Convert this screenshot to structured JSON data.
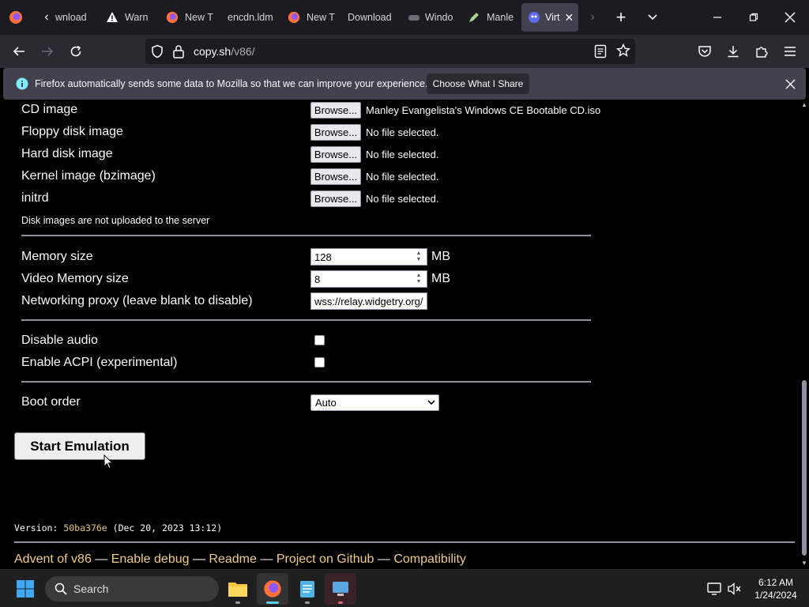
{
  "browser": {
    "tabs": [
      {
        "label": "wnload",
        "icon": "chevron-left-icon"
      },
      {
        "label": "Warn",
        "icon": "warning-icon"
      },
      {
        "label": "New T",
        "icon": "firefox-icon"
      },
      {
        "label": "encdn.ldm",
        "icon": ""
      },
      {
        "label": "New T",
        "icon": "firefox-icon"
      },
      {
        "label": "Download",
        "icon": ""
      },
      {
        "label": "Windo",
        "icon": "gamepad-icon"
      },
      {
        "label": "Manle",
        "icon": "pencil-icon"
      },
      {
        "label": "Virt",
        "icon": "v86-icon",
        "active": true
      }
    ],
    "url_host": "copy.sh",
    "url_path": "/v86/"
  },
  "notification": {
    "text": "Firefox automatically sends some data to Mozilla so that we can improve your experience.",
    "button": "Choose What I Share"
  },
  "form": {
    "files": [
      {
        "label": "CD image",
        "button": "Browse...",
        "value": "Manley Evangelista's Windows CE Bootable CD.iso"
      },
      {
        "label": "Floppy disk image",
        "button": "Browse...",
        "value": "No file selected."
      },
      {
        "label": "Hard disk image",
        "button": "Browse...",
        "value": "No file selected."
      },
      {
        "label": "Kernel image (bzimage)",
        "button": "Browse...",
        "value": "No file selected."
      },
      {
        "label": "initrd",
        "button": "Browse...",
        "value": "No file selected."
      }
    ],
    "disk_note": "Disk images are not uploaded to the server",
    "memory_label": "Memory size",
    "memory_value": "128",
    "memory_unit": "MB",
    "vram_label": "Video Memory size",
    "vram_value": "8",
    "vram_unit": "MB",
    "proxy_label": "Networking proxy (leave blank to disable)",
    "proxy_value": "wss://relay.widgetry.org/",
    "disable_audio_label": "Disable audio",
    "acpi_label": "Enable ACPI (experimental)",
    "boot_label": "Boot order",
    "boot_value": "Auto",
    "start_button": "Start Emulation"
  },
  "version": {
    "prefix": "Version:",
    "hash": "50ba376e",
    "date": "(Dec 20, 2023 13:12)"
  },
  "footer": {
    "links": [
      "Advent of v86",
      "Enable debug",
      "Readme",
      "Project on Github",
      "Compatibility"
    ],
    "separator": "—"
  },
  "taskbar": {
    "search_placeholder": "Search",
    "time": "6:12 AM",
    "date": "1/24/2024"
  },
  "colors": {
    "accent_link": "#f0c98a",
    "version_hash": "#e8c47a",
    "taskbar_active": "#60cdff"
  }
}
